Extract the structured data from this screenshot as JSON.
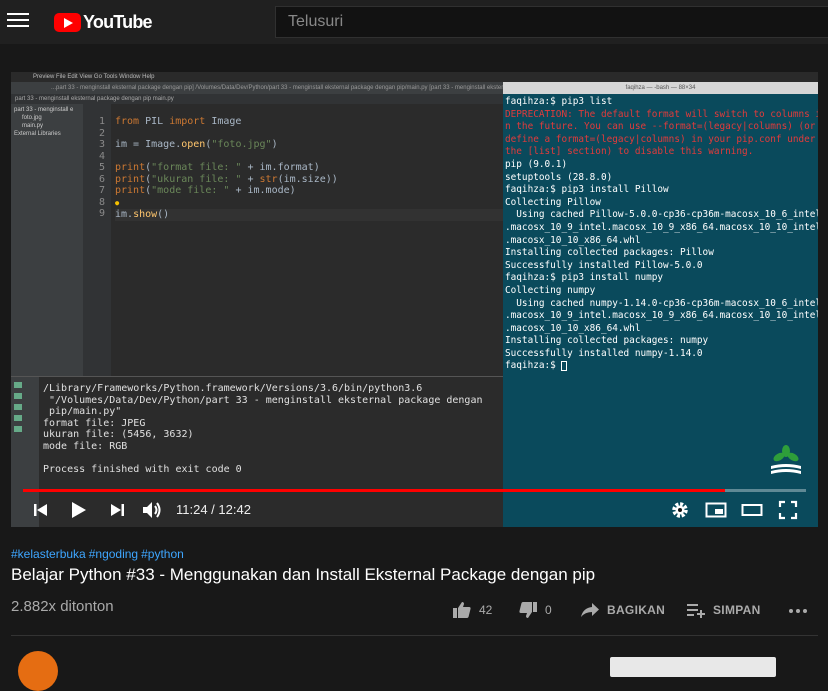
{
  "header": {
    "logo_text": "YouTube",
    "search_placeholder": "Telusuri"
  },
  "video": {
    "ide": {
      "menubar": "Preview  File  Edit  View  Go  Tools  Window  Help",
      "title": "...part 33 - menginstall eksternal package dengan pip] /Volumes/Data/Dev/Python/part 33 - menginstall eksternal package dengan pip/main.py [part 33 - menginstall eksternal package dengan pip]",
      "tabs": "part 33 - menginstall eksternal package dengan pip    main.py",
      "project_tree": [
        "part 33 - menginstall e",
        "foto.jpg",
        "main.py",
        "External Libraries"
      ],
      "line_numbers": [
        "1",
        "2",
        "3",
        "4",
        "5",
        "6",
        "7",
        "8",
        "9"
      ],
      "run_output": [
        "/Library/Frameworks/Python.framework/Versions/3.6/bin/python3.6",
        " \"/Volumes/Data/Dev/Python/part 33 - menginstall eksternal package dengan",
        " pip/main.py\"",
        "format file: JPEG",
        "ukuran file: (5456, 3632)",
        "mode file: RGB",
        "",
        "Process finished with exit code 0"
      ]
    },
    "terminal": {
      "title": "faqihza — -bash — 88×34",
      "prompt_line_1": "faqihza:$ pip3 list",
      "warning": "DEPRECATION: The default format will switch to columns in the future. You can use --format=(legacy|columns) (or define a format=(legacy|columns) in your pip.conf under the [list] section) to disable this warning.",
      "lines": [
        "pip (9.0.1)",
        "setuptools (28.8.0)",
        "faqihza:$ pip3 install Pillow",
        "Collecting Pillow",
        "  Using cached Pillow-5.0.0-cp36-cp36m-macosx_10_6_intel",
        ".macosx_10_9_intel.macosx_10_9_x86_64.macosx_10_10_intel",
        ".macosx_10_10_x86_64.whl",
        "Installing collected packages: Pillow",
        "Successfully installed Pillow-5.0.0",
        "faqihza:$ pip3 install numpy",
        "Collecting numpy",
        "  Using cached numpy-1.14.0-cp36-cp36m-macosx_10_6_intel",
        ".macosx_10_9_intel.macosx_10_9_x86_64.macosx_10_10_intel",
        ".macosx_10_10_x86_64.whl",
        "Installing collected packages: numpy",
        "Successfully installed numpy-1.14.0"
      ],
      "final_prompt": "faqihza:$ "
    },
    "player": {
      "current_time": "11:24",
      "duration": "12:42",
      "time_display": "11:24 / 12:42",
      "progress_fraction": 0.897
    }
  },
  "meta": {
    "hashtags": [
      "#kelasterbuka",
      "#ngoding",
      "#python"
    ],
    "title": "Belajar Python #33 - Menggunakan dan Install Eksternal Package dengan pip",
    "views": "2.882x ditonton",
    "likes": "42",
    "dislikes": "0",
    "share_label": "BAGIKAN",
    "save_label": "SIMPAN"
  },
  "colors": {
    "accent": "#ff0000",
    "link": "#3ea6ff",
    "terminal_bg": "#0a4a5c",
    "warning": "#e23b3b"
  }
}
